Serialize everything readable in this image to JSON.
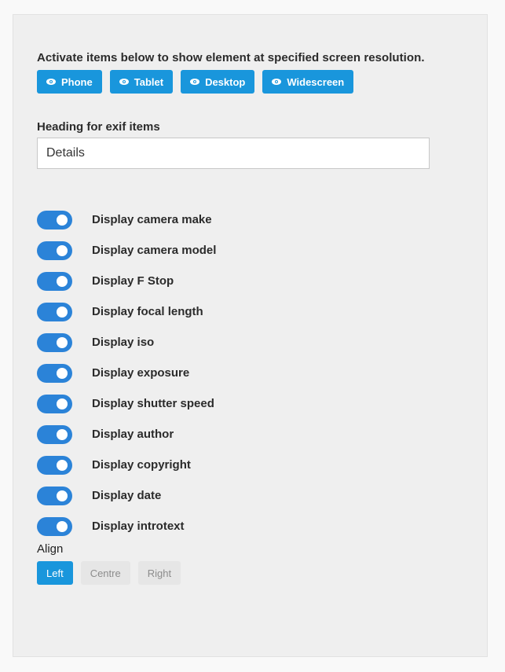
{
  "description": "Activate items below to show element at specified screen resolution.",
  "devices": [
    {
      "label": "Phone",
      "icon": "eye-icon"
    },
    {
      "label": "Tablet",
      "icon": "eye-icon"
    },
    {
      "label": "Desktop",
      "icon": "eye-icon"
    },
    {
      "label": "Widescreen",
      "icon": "eye-icon"
    }
  ],
  "heading_field": {
    "label": "Heading for exif items",
    "value": "Details"
  },
  "toggles": [
    {
      "label": "Display camera make",
      "on": true
    },
    {
      "label": "Display camera model",
      "on": true
    },
    {
      "label": "Display F Stop",
      "on": true
    },
    {
      "label": "Display focal length",
      "on": true
    },
    {
      "label": "Display iso",
      "on": true
    },
    {
      "label": "Display exposure",
      "on": true
    },
    {
      "label": "Display shutter speed",
      "on": true
    },
    {
      "label": "Display author",
      "on": true
    },
    {
      "label": "Display copyright",
      "on": true
    },
    {
      "label": "Display date",
      "on": true
    },
    {
      "label": "Display introtext",
      "on": true
    }
  ],
  "align": {
    "label": "Align",
    "options": [
      "Left",
      "Centre",
      "Right"
    ],
    "selected": "Left"
  },
  "colors": {
    "accent": "#1996dc",
    "toggle_on": "#2b83d8",
    "panel_bg": "#efefef"
  }
}
